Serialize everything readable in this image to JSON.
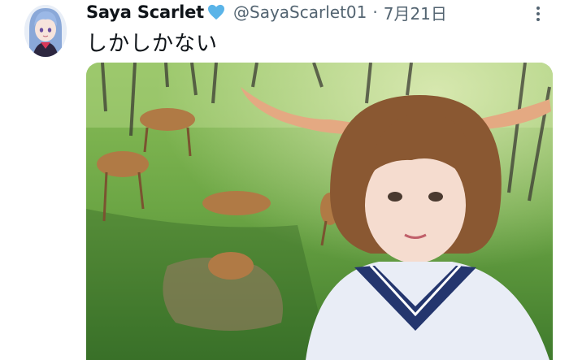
{
  "tweet": {
    "author": {
      "display_name": "Saya Scarlet",
      "handle": "@SayaScarlet01",
      "badge_icon": "light-blue-heart-icon",
      "avatar_icon": "anime-girl-avatar"
    },
    "separator": "·",
    "date": "7月21日",
    "more_icon": "more-vertical-icon",
    "text": "しかしかない",
    "media": {
      "type": "photo",
      "description_icon": "cosplay-selfie-with-deer-photo"
    }
  },
  "colors": {
    "text_primary": "#0f1419",
    "text_secondary": "#536471",
    "heart": "#5ab4e8",
    "background": "#ffffff"
  }
}
